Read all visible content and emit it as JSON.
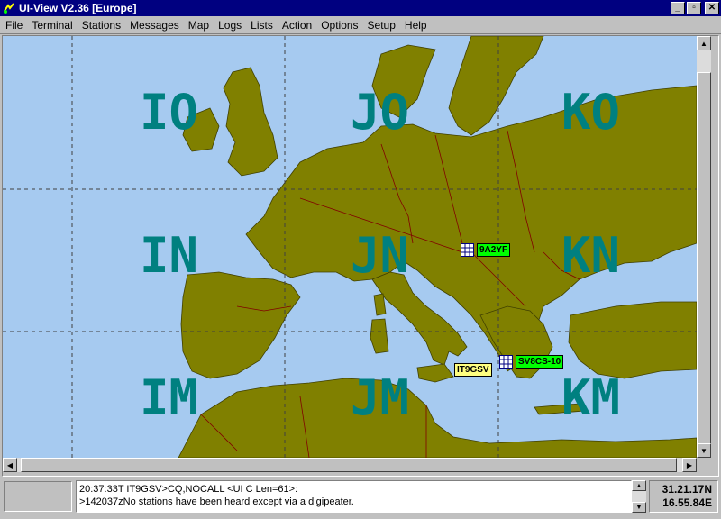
{
  "window": {
    "title": "UI-View V2.36 [Europe]",
    "buttons": {
      "minimize": "_",
      "maximize": "▫",
      "close": "✕"
    }
  },
  "menu": [
    "File",
    "Terminal",
    "Stations",
    "Messages",
    "Map",
    "Logs",
    "Lists",
    "Action",
    "Options",
    "Setup",
    "Help"
  ],
  "map": {
    "colors": {
      "sea": "#a6caf0",
      "land": "#808000",
      "border": "#800000",
      "grid_label": "#008080",
      "station_green": "#00ff00",
      "station_yellow": "#ffff80"
    },
    "grid_labels": [
      "IO",
      "JO",
      "KO",
      "IN",
      "JN",
      "KN",
      "IM",
      "JM",
      "KM"
    ],
    "stations": [
      {
        "call": "9A2YF",
        "symbol": "grid-icon",
        "color": "green"
      },
      {
        "call": "SV8CS-10",
        "symbol": "grid-icon",
        "color": "green"
      },
      {
        "call": "IT9GSV",
        "symbol": "",
        "color": "yellow"
      }
    ]
  },
  "monitor": {
    "lines": [
      "20:37:33T IT9GSV>CQ,NOCALL <UI C Len=61>:",
      ">142037zNo stations have been heard except via a digipeater."
    ]
  },
  "position": {
    "lat": "31.21.17N",
    "lon": "16.55.84E"
  }
}
